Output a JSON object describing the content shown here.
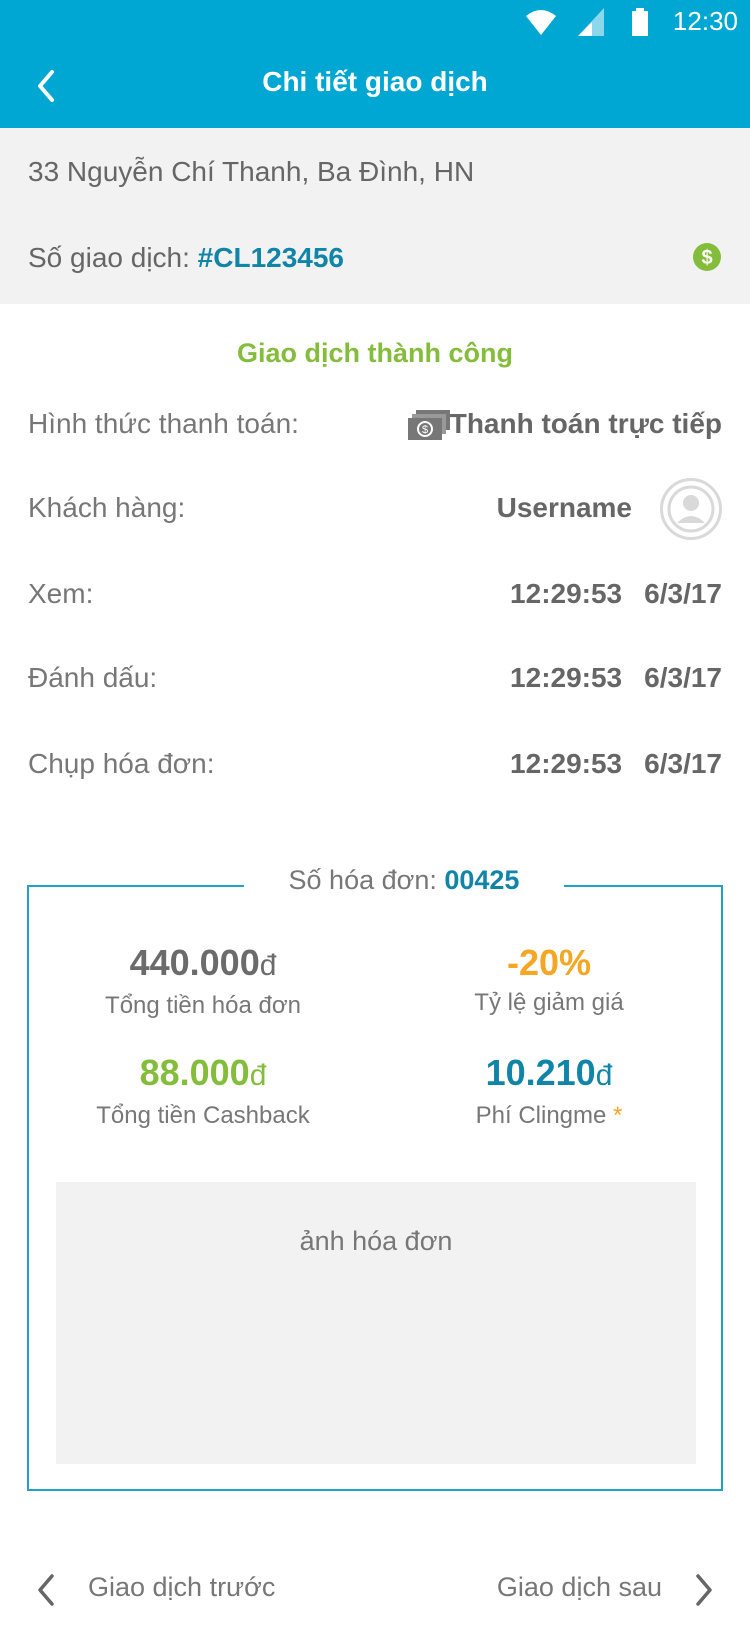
{
  "status_bar": {
    "time": "12:30"
  },
  "app_bar": {
    "title": "Chi tiết giao dịch"
  },
  "header": {
    "address": "33 Nguyễn Chí Thanh, Ba Đình, HN",
    "txn_label": "Số giao dịch: ",
    "txn_code": "#CL123456"
  },
  "status": "Giao dịch thành công",
  "details": {
    "payment_label": "Hình thức thanh toán:",
    "payment_value": "Thanh toán trực tiếp",
    "customer_label": "Khách hàng:",
    "customer_value": "Username",
    "view_label": "Xem:",
    "view_time": "12:29:53",
    "view_date": "6/3/17",
    "mark_label": "Đánh dấu:",
    "mark_time": "12:29:53",
    "mark_date": "6/3/17",
    "capture_label": "Chụp hóa đơn:",
    "capture_time": "12:29:53",
    "capture_date": "6/3/17"
  },
  "invoice": {
    "label": "Số hóa đơn: ",
    "number": "00425",
    "total_value": "440.000",
    "total_currency": "đ",
    "total_caption": "Tổng tiền hóa đơn",
    "discount_value": "-20%",
    "discount_caption": "Tỷ lệ giảm giá",
    "cashback_value": "88.000",
    "cashback_currency": "đ",
    "cashback_caption": "Tổng tiền Cashback",
    "fee_value": "10.210",
    "fee_currency": "đ",
    "fee_caption": "Phí Clingme ",
    "fee_asterisk": "*",
    "photo_label": "ảnh hóa đơn"
  },
  "nav": {
    "prev": "Giao dịch trước",
    "next": "Giao dịch sau"
  },
  "colors": {
    "primary": "#00a7d3",
    "success": "#84bd3b",
    "accent_blue": "#1185a8",
    "discount": "#f5a623"
  }
}
